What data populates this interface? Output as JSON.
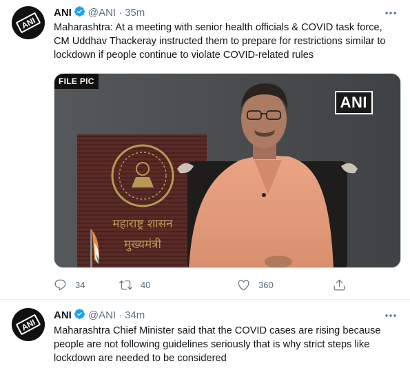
{
  "tweets": [
    {
      "name": "ANI",
      "handle": "@ANI",
      "separator": "·",
      "time": "35m",
      "text_lines": [
        "Maharashtra: At a meeting with senior health officials & COVID task force,",
        "CM Uddhav Thackeray instructed them to prepare for restrictions similar to",
        "lockdown if people continue to violate COVID-related rules"
      ],
      "media": {
        "label_left": "FILE PIC",
        "label_right": "ANI",
        "plaque_lines": [
          "महाराष्ट्र शासन",
          "मुख्यमंत्री"
        ]
      },
      "actions": {
        "replies": "34",
        "retweets": "40",
        "likes": "360"
      }
    },
    {
      "name": "ANI",
      "handle": "@ANI",
      "separator": "·",
      "time": "34m",
      "text_lines": [
        "Maharashtra Chief Minister said that the COVID cases are rising because",
        "people are not following guidelines seriously that is why strict steps like",
        "lockdown are needed to be considered"
      ]
    }
  ],
  "avatar_text": "ANI",
  "icons": {
    "verified": "verified-badge-icon",
    "more": "more-icon",
    "reply": "reply-icon",
    "retweet": "retweet-icon",
    "like": "like-icon",
    "share": "share-icon"
  },
  "colors": {
    "verified": "#1da1f2",
    "secondary_text": "#5b7083",
    "divider": "#ebeef0"
  }
}
